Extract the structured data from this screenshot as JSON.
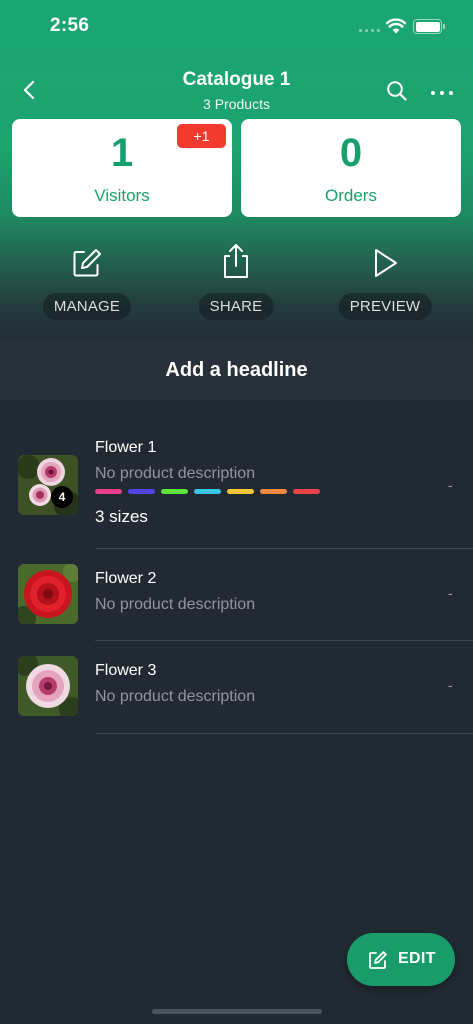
{
  "status_bar": {
    "time": "2:56"
  },
  "nav": {
    "title": "Catalogue 1",
    "subtitle": "3 Products"
  },
  "stats": {
    "visitors": {
      "value": "1",
      "label": "Visitors",
      "badge": "+1"
    },
    "orders": {
      "value": "0",
      "label": "Orders"
    }
  },
  "actions": [
    {
      "label": "MANAGE",
      "icon": "edit-icon"
    },
    {
      "label": "SHARE",
      "icon": "share-icon"
    },
    {
      "label": "PREVIEW",
      "icon": "play-icon"
    }
  ],
  "headline": "Add a headline",
  "products": [
    {
      "name": "Flower 1",
      "description": "No product description",
      "sizes": "3 sizes",
      "price": "-",
      "image_count": "4",
      "color_swatches": [
        "#e83e8c",
        "#4f46e5",
        "#5ee23c",
        "#38c6e8",
        "#f5c737",
        "#f08a3e",
        "#ec4349"
      ]
    },
    {
      "name": "Flower 2",
      "description": "No product description",
      "price": "-"
    },
    {
      "name": "Flower 3",
      "description": "No product description",
      "price": "-"
    }
  ],
  "fab": {
    "label": "EDIT",
    "icon": "edit-icon"
  },
  "colors": {
    "brand_green": "#1aa673",
    "background": "#212a33",
    "badge_red": "#f23b2f"
  }
}
